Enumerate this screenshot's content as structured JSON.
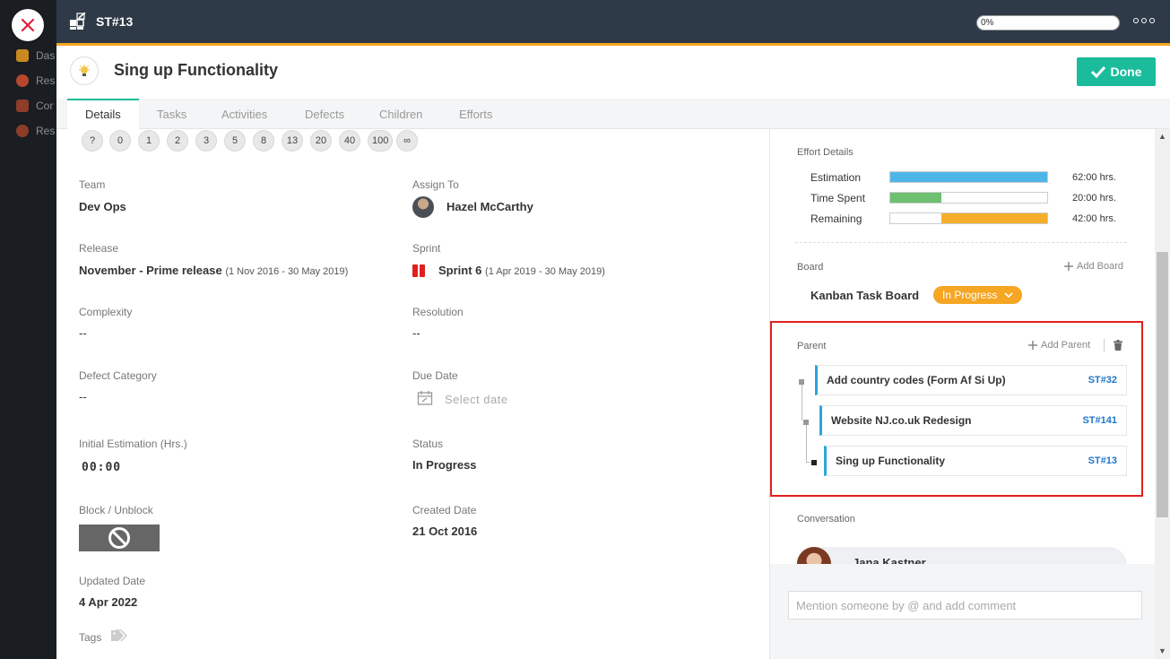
{
  "background_nav": {
    "items": [
      "Das",
      "Res",
      "Cor",
      "Res"
    ]
  },
  "header": {
    "item_id": "ST#13",
    "progress": "0%",
    "progress_value": 0
  },
  "title": "Sing up Functionality",
  "done_label": "Done",
  "tabs": [
    {
      "label": "Details",
      "active": true
    },
    {
      "label": "Tasks"
    },
    {
      "label": "Activities"
    },
    {
      "label": "Defects"
    },
    {
      "label": "Children"
    },
    {
      "label": "Efforts"
    }
  ],
  "story_points": [
    "?",
    "0",
    "1",
    "2",
    "3",
    "5",
    "8",
    "13",
    "20",
    "40",
    "100",
    "∞"
  ],
  "fields": {
    "team": {
      "label": "Team",
      "value": "Dev Ops"
    },
    "assign_to": {
      "label": "Assign To",
      "value": "Hazel McCarthy"
    },
    "release": {
      "label": "Release",
      "value": "November - Prime release",
      "range": "(1 Nov 2016 - 30 May 2019)"
    },
    "sprint": {
      "label": "Sprint",
      "value": "Sprint 6",
      "range": "(1 Apr 2019 - 30 May 2019)"
    },
    "complexity": {
      "label": "Complexity",
      "value": "--"
    },
    "resolution": {
      "label": "Resolution",
      "value": "--"
    },
    "defect_category": {
      "label": "Defect Category",
      "value": "--"
    },
    "due_date": {
      "label": "Due Date",
      "placeholder": "Select date"
    },
    "initial_estimation": {
      "label": "Initial Estimation (Hrs.)",
      "value": "00:00"
    },
    "status": {
      "label": "Status",
      "value": "In Progress"
    },
    "block": {
      "label": "Block / Unblock"
    },
    "created_date": {
      "label": "Created Date",
      "value": "21 Oct 2016"
    },
    "updated_date": {
      "label": "Updated Date",
      "value": "4 Apr 2022"
    },
    "tags": {
      "label": "Tags"
    }
  },
  "effort": {
    "title": "Effort Details",
    "rows": [
      {
        "label": "Estimation",
        "value": "62:00 hrs.",
        "fraction": 1.0,
        "offset": 0,
        "color": "#4db6e8"
      },
      {
        "label": "Time Spent",
        "value": "20:00 hrs.",
        "fraction": 0.323,
        "offset": 0,
        "color": "#6cc070"
      },
      {
        "label": "Remaining",
        "value": "42:00 hrs.",
        "fraction": 0.677,
        "offset": 0.323,
        "color": "#f5ae2a"
      }
    ]
  },
  "board": {
    "label": "Board",
    "add_label": "Add Board",
    "name": "Kanban Task Board",
    "status": "In Progress"
  },
  "parent": {
    "label": "Parent",
    "add_label": "Add Parent",
    "items": [
      {
        "name": "Add country codes (Form Af Si Up)",
        "id": "ST#32"
      },
      {
        "name": "Website NJ.co.uk Redesign",
        "id": "ST#141"
      },
      {
        "name": "Sing up Functionality",
        "id": "ST#13"
      }
    ]
  },
  "conversation": {
    "label": "Conversation",
    "author": "Jana Kastner",
    "comment_placeholder": "Mention someone by @ and add comment"
  },
  "colors": {
    "accent": "#1abc9c",
    "header_bg": "#2f3a48",
    "header_border": "#f5a623",
    "highlight": "#e02020",
    "link": "#2176c8"
  }
}
